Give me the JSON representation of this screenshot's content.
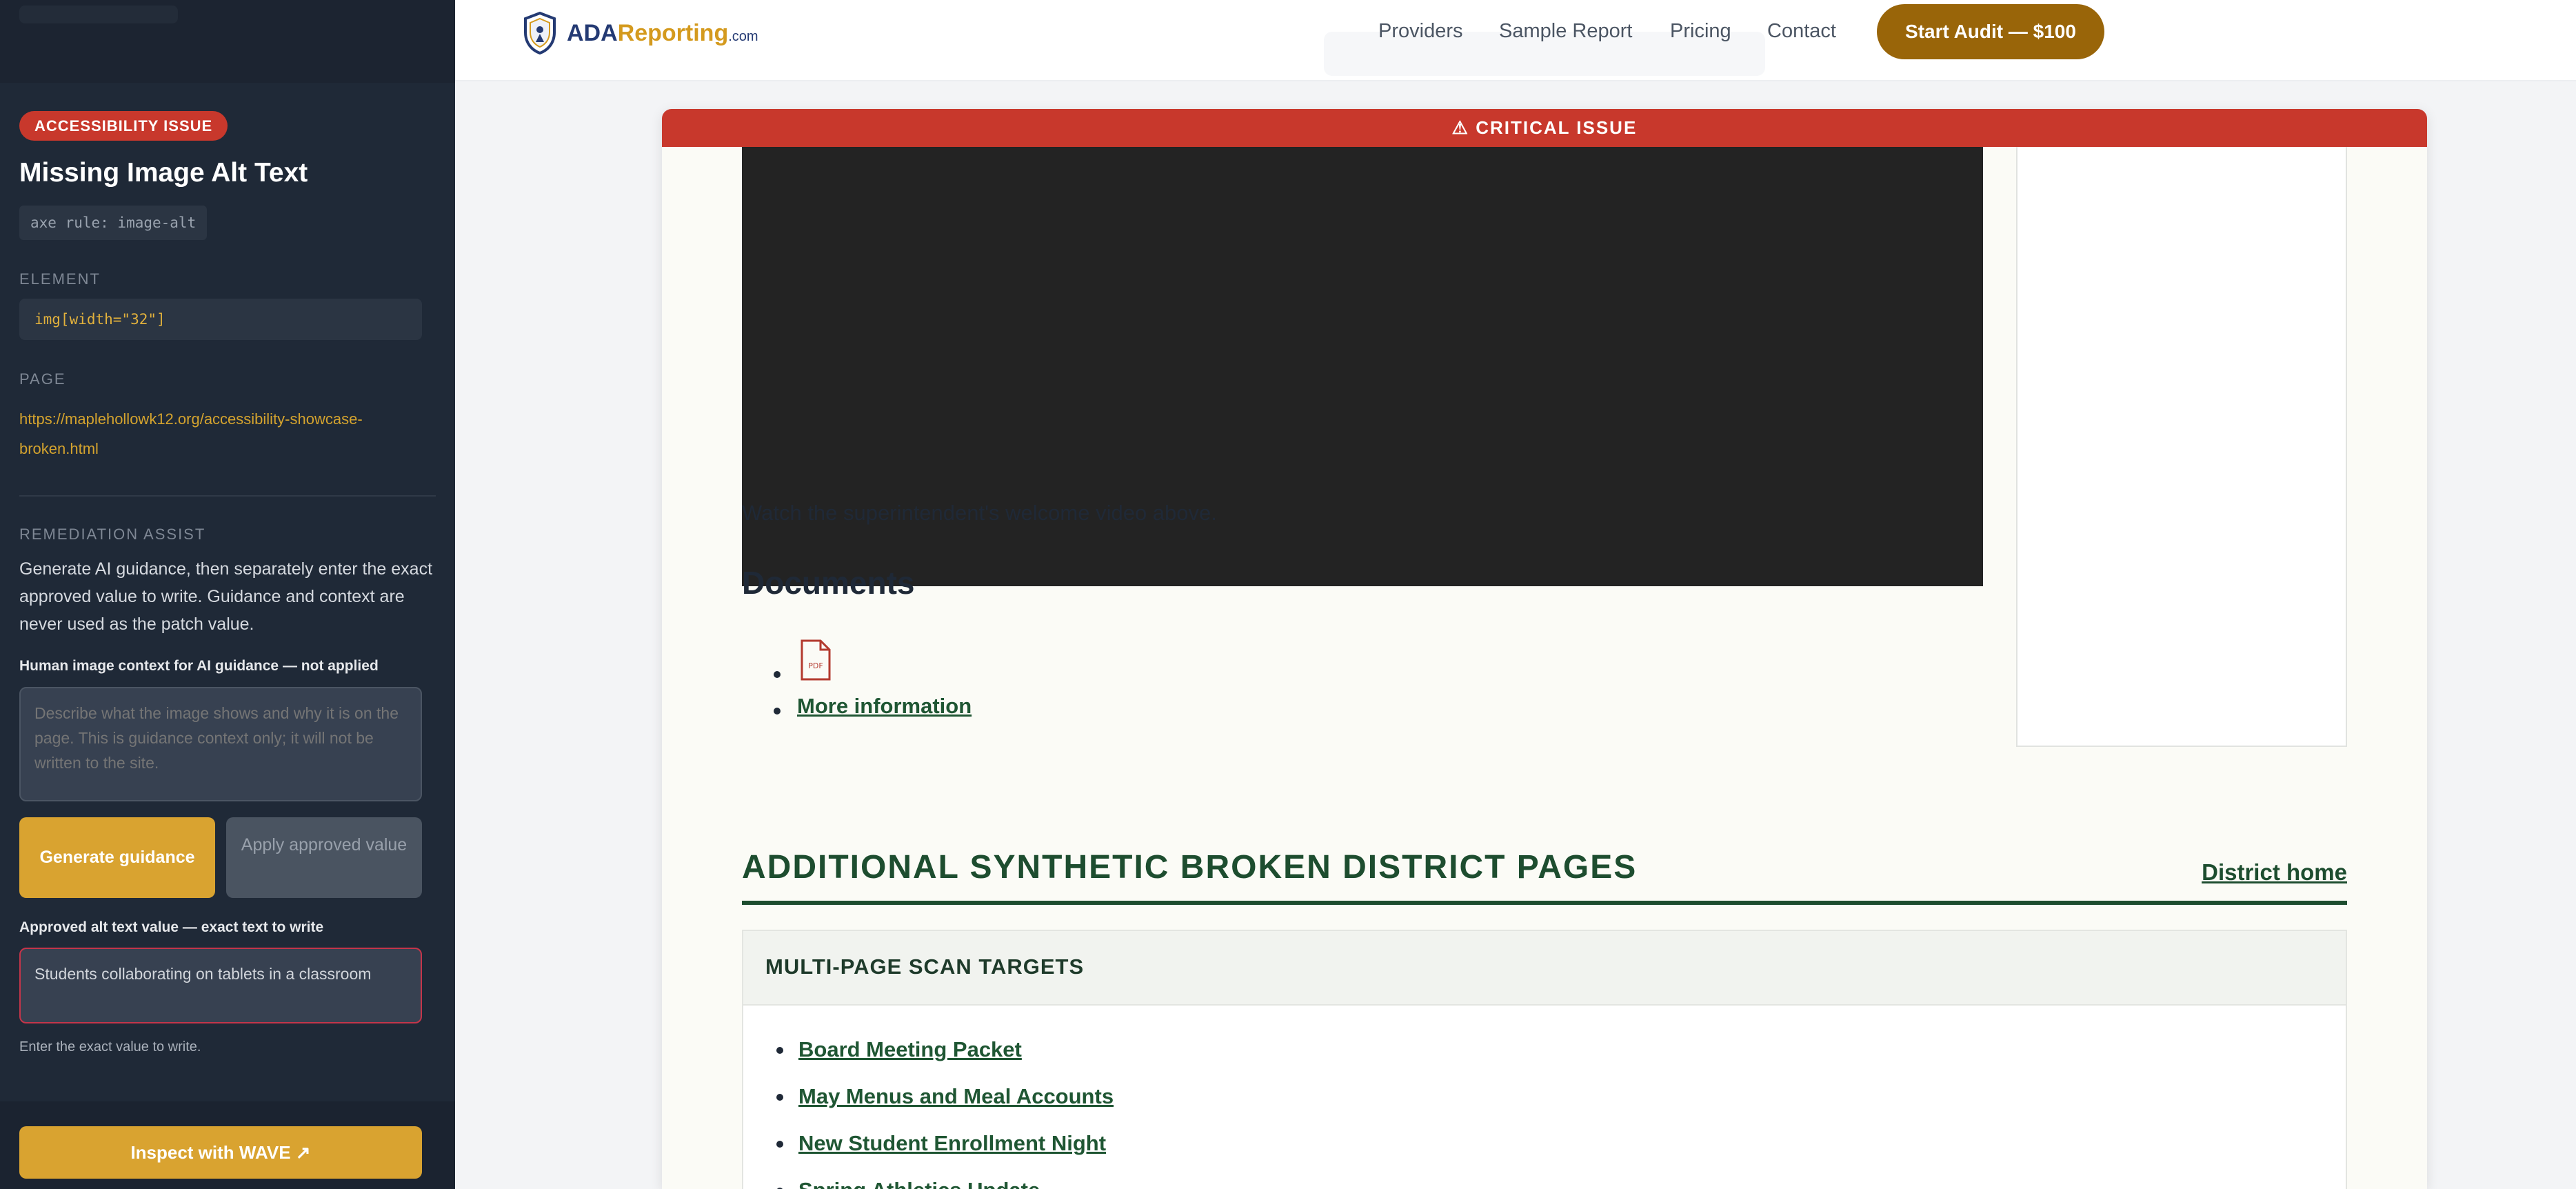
{
  "sidebar": {
    "badge": "ACCESSIBILITY ISSUE",
    "title": "Missing Image Alt Text",
    "rule": "axe rule: image-alt",
    "element_label": "ELEMENT",
    "element_value": "img[width=\"32\"]",
    "page_label": "PAGE",
    "page_url": "https://maplehollowk12.org/accessibility-showcase-broken.html",
    "assist_label": "REMEDIATION ASSIST",
    "assist_description": "Generate AI guidance, then separately enter the exact approved value to write. Guidance and context are never used as the patch value.",
    "context_label": "Human image context for AI guidance — not applied",
    "context_placeholder": "Describe what the image shows and why it is on the page. This is guidance context only; it will not be written to the site.",
    "generate_button": "Generate guidance",
    "apply_button": "Apply approved value",
    "approved_label": "Approved alt text value — exact text to write",
    "approved_value": "Students collaborating on tablets in a classroom",
    "hint": "Enter the exact value to write.",
    "wave_button": "Inspect with WAVE ↗"
  },
  "header": {
    "logo_main": "ADA",
    "logo_accent": "Reporting",
    "logo_domain": ".com",
    "nav": [
      "Providers",
      "Sample Report",
      "Pricing",
      "Contact"
    ],
    "cta": "Start Audit — $100"
  },
  "main": {
    "critical_banner": "⚠ CRITICAL ISSUE",
    "video_caption": "Watch the superintendent's welcome video above.",
    "documents_heading": "Documents",
    "pdf_label": "PDF",
    "more_info_link": "More information",
    "section_heading": "ADDITIONAL SYNTHETIC BROKEN DISTRICT PAGES",
    "district_home_link": "District home",
    "targets_title": "MULTI-PAGE SCAN TARGETS",
    "targets": [
      "Board Meeting Packet",
      "May Menus and Meal Accounts",
      "New Student Enrollment Night",
      "Spring Athletics Update"
    ]
  },
  "colors": {
    "sidebar_bg": "#1f2937",
    "critical_red": "#c8382c",
    "accent_gold": "#d9a330",
    "cta_brown": "#996509",
    "district_green": "#1d4d2f"
  },
  "icons": {
    "logo": "shield-icon",
    "pdf": "pdf-file-icon",
    "warning": "warning-icon",
    "external": "external-link-icon"
  }
}
